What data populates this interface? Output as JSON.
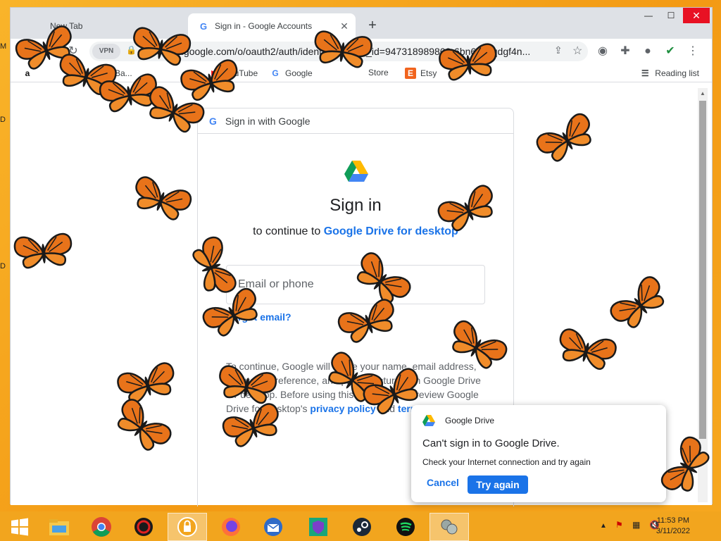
{
  "desktop": {
    "left_stub_letters": [
      "M",
      "D",
      "D"
    ]
  },
  "browser": {
    "tabs": [
      {
        "title": "New Tab",
        "active": false
      },
      {
        "title": "Sign in - Google Accounts",
        "active": true
      }
    ],
    "new_tab_symbol": "+",
    "window_controls": {
      "minimize": "—",
      "maximize": "☐",
      "close": "✕"
    },
    "omnibox": {
      "vpn_label": "VPN",
      "url": "accounts.google.com/o/oauth2/auth/identifier?client_id=947318989803-6bn6qk8qdgf4n..."
    },
    "bookmarks": [
      {
        "label": "",
        "icon": "amazon-icon",
        "icon_text": "a"
      },
      {
        "label": "Ba...",
        "icon": "bag-icon",
        "icon_text": "🛍"
      },
      {
        "label": "Yo...",
        "icon": "youtube-icon",
        "icon_text": "▶"
      },
      {
        "label": "YouTube",
        "icon": "youtube-icon",
        "icon_text": ""
      },
      {
        "label": "Google",
        "icon": "google-icon",
        "icon_text": "G"
      },
      {
        "label": "Store",
        "icon": "store-icon",
        "icon_text": ""
      },
      {
        "label": "Etsy",
        "icon": "etsy-icon",
        "icon_text": "E"
      }
    ],
    "reading_list": "Reading list"
  },
  "signin": {
    "header": "Sign in with Google",
    "title": "Sign in",
    "subtitle_prefix": "to continue to ",
    "subtitle_link": "Google Drive for desktop",
    "email_placeholder": "Email or phone",
    "forgot_email": "Forgot email?",
    "privacy_parts": {
      "before": "To continue, Google will share your name, email address, language preference, and profile picture with Google Drive for desktop. Before using this app, you can review Google Drive for desktop's ",
      "privacy_link": "privacy policy",
      "middle": " and ",
      "terms_link": "terms of service",
      "after": "."
    }
  },
  "notification": {
    "app": "Google Drive",
    "title": "Can't sign in to Google Drive.",
    "message": "Check your Internet connection and try again",
    "cancel": "Cancel",
    "retry": "Try again"
  },
  "taskbar": {
    "apps": [
      {
        "name": "start-icon",
        "active": false
      },
      {
        "name": "file-explorer-icon",
        "active": false
      },
      {
        "name": "chrome-icon",
        "active": false
      },
      {
        "name": "red-app-icon",
        "active": false
      },
      {
        "name": "vpn-lock-icon",
        "active": true
      },
      {
        "name": "firefox-icon",
        "active": false
      },
      {
        "name": "thunderbird-icon",
        "active": false
      },
      {
        "name": "shield-app-icon",
        "active": false
      },
      {
        "name": "steam-icon",
        "active": false
      },
      {
        "name": "spotify-icon",
        "active": false
      },
      {
        "name": "network-app-icon",
        "active": false
      }
    ],
    "tray_chevron": "▲",
    "time": "11:53 PM",
    "date": "3/11/2022"
  },
  "colors": {
    "accent": "#1a73e8",
    "desktop": "#f39a14",
    "butterfly_orange": "#e8731a",
    "close_red": "#e81123"
  }
}
